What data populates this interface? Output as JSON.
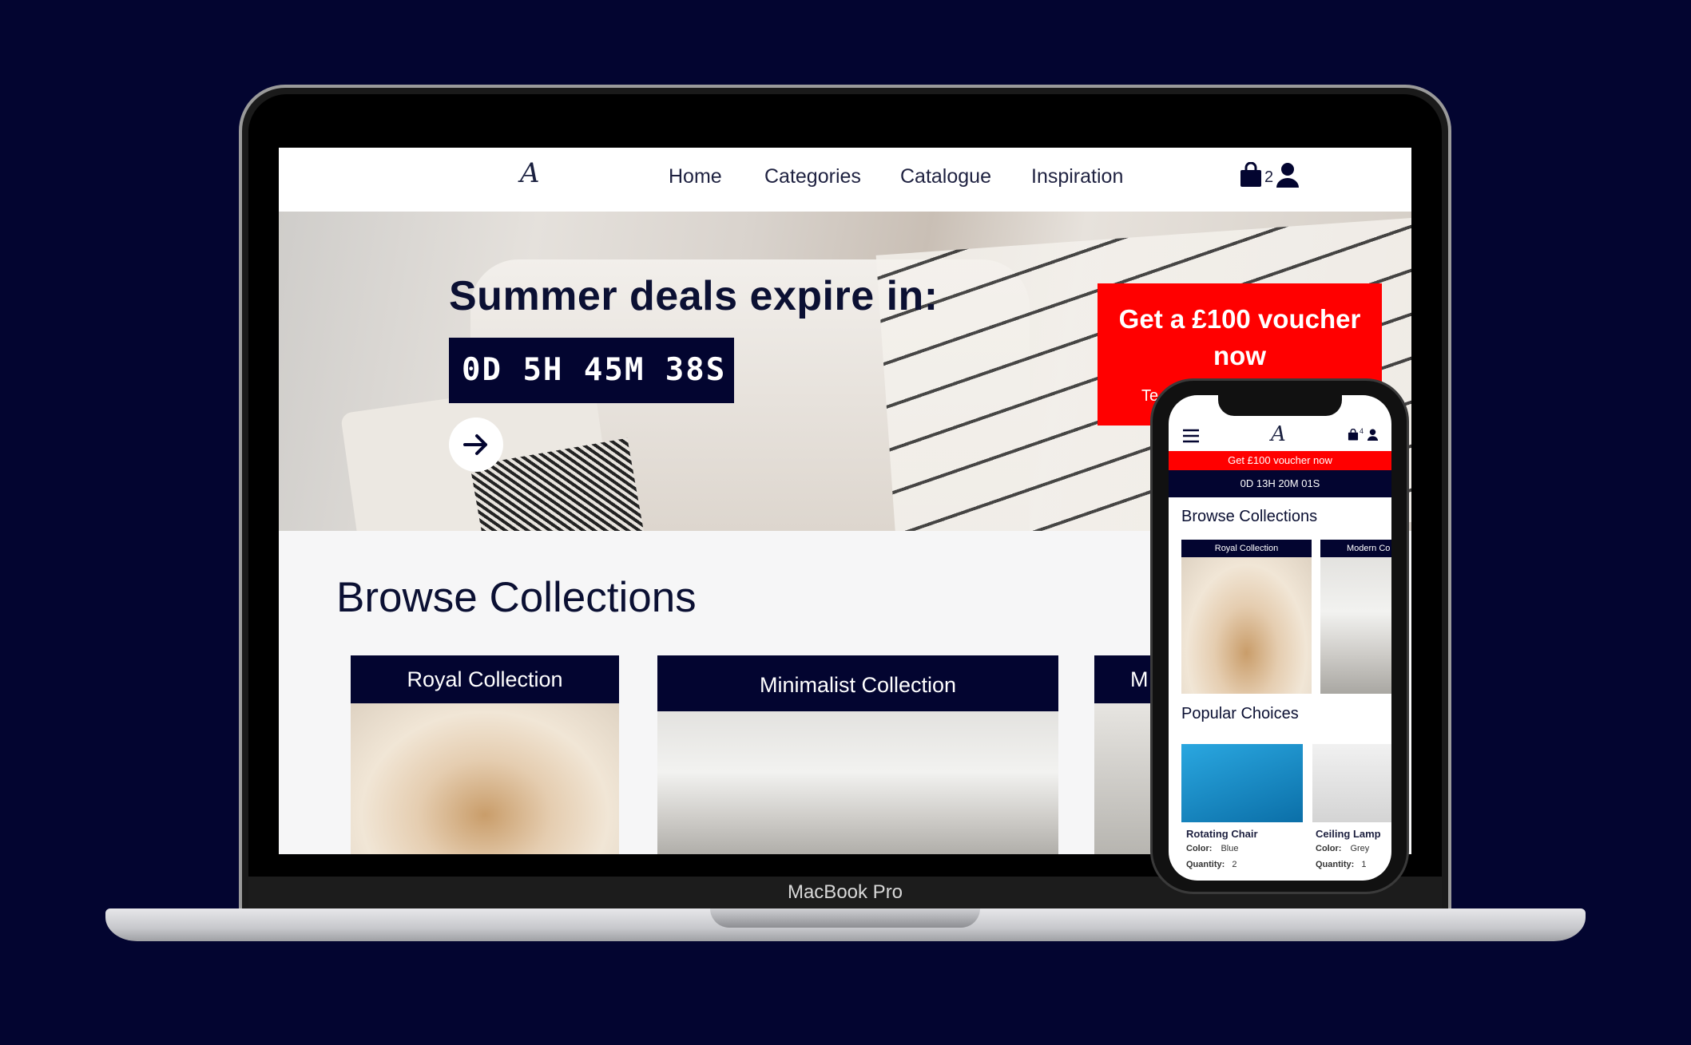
{
  "device_label": "MacBook Pro",
  "desktop": {
    "nav": {
      "logo": "A",
      "links": [
        "Home",
        "Categories",
        "Catalogue",
        "Inspiration"
      ],
      "cart_count": "2"
    },
    "hero": {
      "title": "Summer deals expire in:",
      "countdown": "0D 5H 45M 38S",
      "voucher": "Get a £100 voucher now",
      "voucher_sub": "Te"
    },
    "browse": {
      "title": "Browse Collections",
      "collections": [
        "Royal Collection",
        "Minimalist Collection",
        "M"
      ]
    }
  },
  "mobile": {
    "logo": "A",
    "cart_count": "4",
    "voucher_banner": "Get £100 voucher now",
    "countdown": "0D 13H 20M 01S",
    "browse_title": "Browse Collections",
    "collections": [
      "Royal Collection",
      "Modern Co"
    ],
    "popular_title": "Popular Choices",
    "products": [
      {
        "name": "Rotating Chair",
        "color_label": "Color:",
        "color": "Blue",
        "qty_label": "Quantity:",
        "qty": "2"
      },
      {
        "name": "Ceiling Lamp",
        "color_label": "Color:",
        "color": "Grey",
        "qty_label": "Quantity:",
        "qty": "1"
      }
    ]
  },
  "colors": {
    "background": "#030530",
    "navy": "#030530",
    "accent_red": "#ff0000"
  }
}
